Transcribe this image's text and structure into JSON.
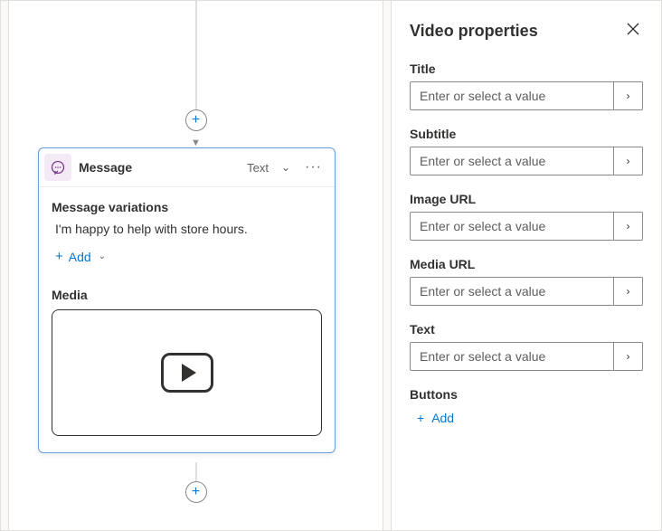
{
  "canvas": {
    "card": {
      "title": "Message",
      "type": "Text",
      "variations_label": "Message variations",
      "variation_text": "I'm happy to help with store hours.",
      "add_label": "Add",
      "media_label": "Media"
    }
  },
  "panel": {
    "title": "Video properties",
    "placeholder": "Enter or select a value",
    "fields": {
      "title": "Title",
      "subtitle": "Subtitle",
      "image_url": "Image URL",
      "media_url": "Media URL",
      "text": "Text",
      "buttons": "Buttons"
    },
    "add_label": "Add"
  }
}
